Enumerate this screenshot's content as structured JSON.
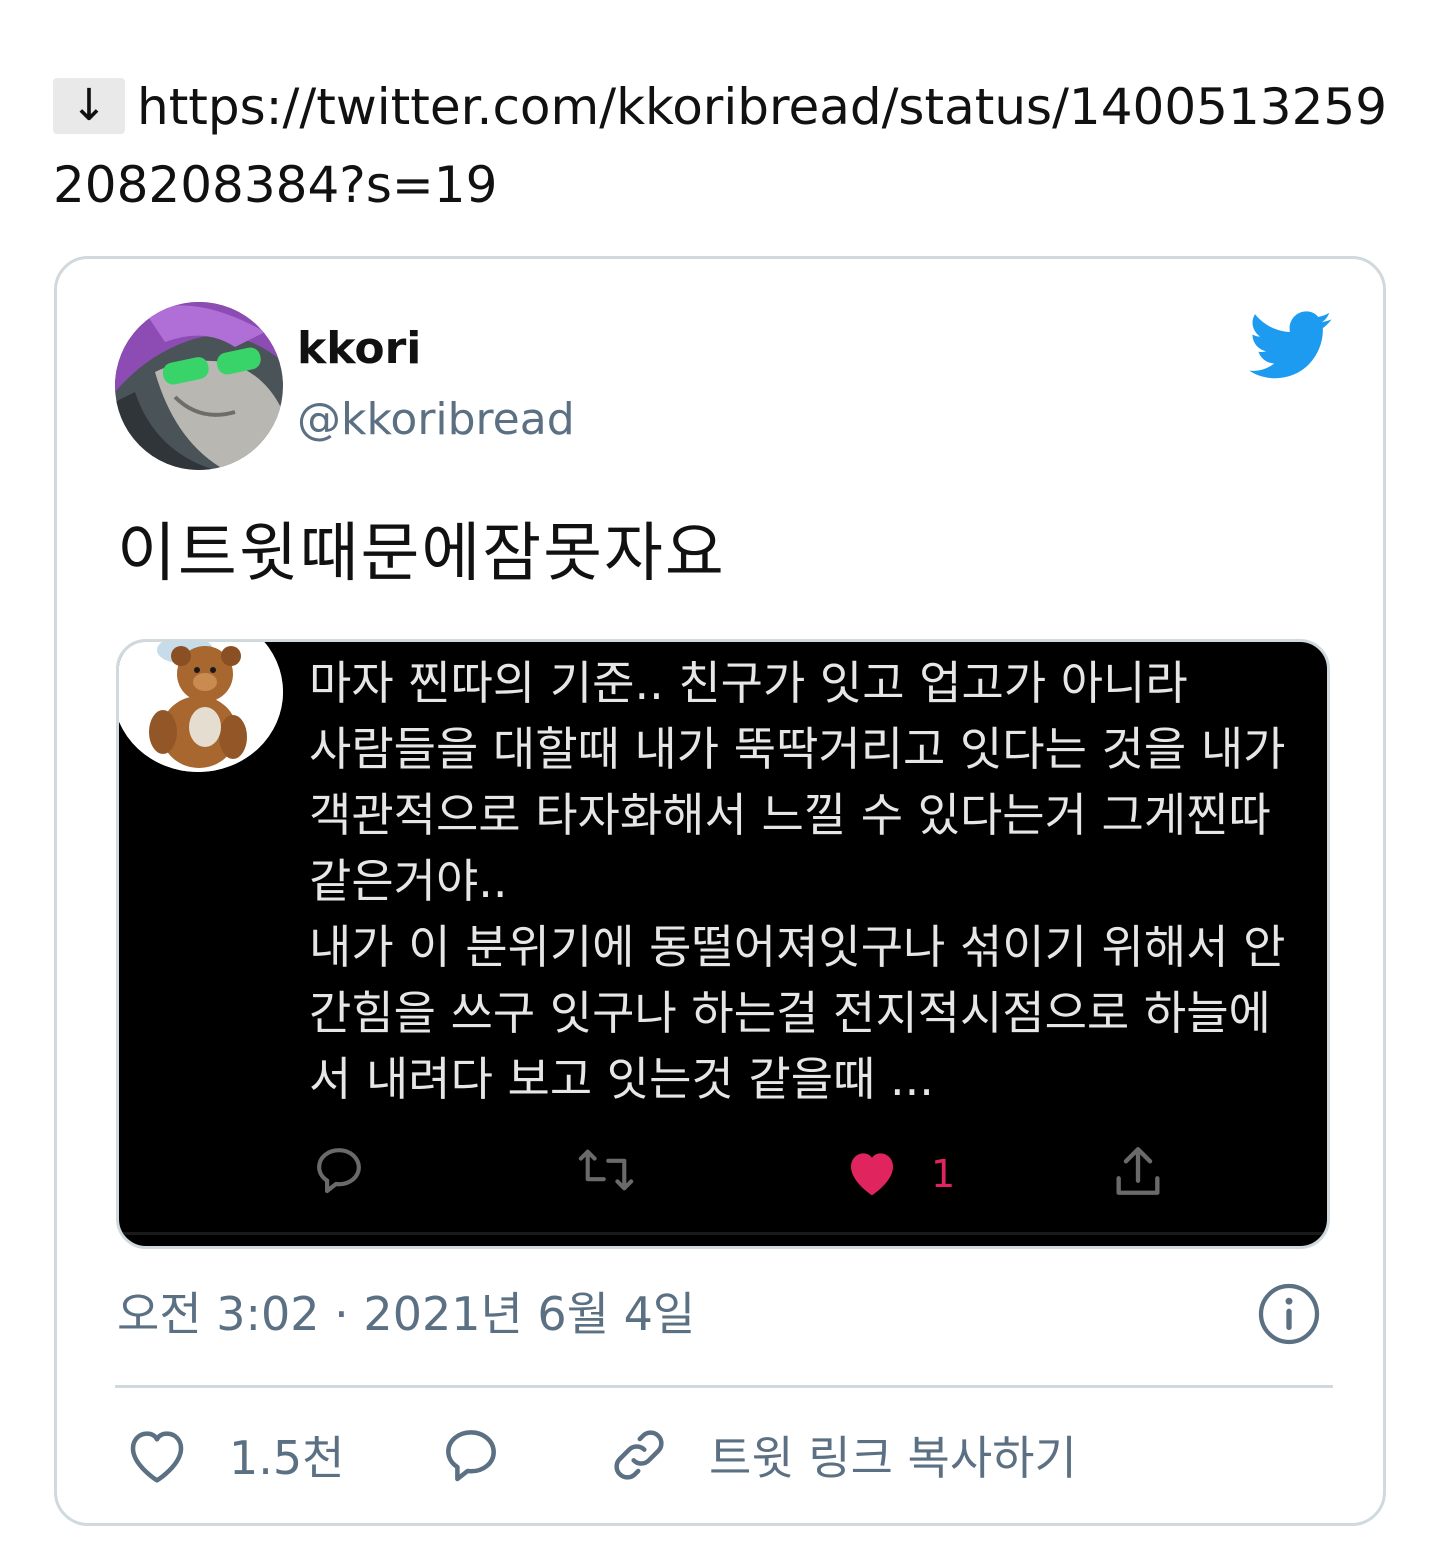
{
  "header": {
    "download_symbol": "↓",
    "url": "https://twitter.com/kkoribread/status/1400513259208208384?s=19"
  },
  "tweet": {
    "display_name": "kkori",
    "handle": "@kkoribread",
    "text": "이트윗때문에잠못자요",
    "timestamp": "오전 3:02 · 2021년 6월 4일",
    "like_count": "1.5천",
    "copy_link_label": "트윗 링크 복사하기"
  },
  "embedded_image": {
    "text": "마자 찐따의 기준.. 친구가 잇고 업고가 아니라\n사람들을 대할때 내가 뚝딱거리고 잇다는 것을 내가\n객관적으로 타자화해서 느낄 수 있다는거 그게찐따\n같은거야..\n내가 이 분위기에 동떨어져잇구나 섞이기 위해서 안\n간힘을 쓰구 잇구나 하는걸 전지적시점으로 하늘에\n서 내려다 보고 잇는것 같을때 ...",
    "like_count": "1"
  },
  "colors": {
    "twitter_blue": "#1d9bf0",
    "like_red": "#e0245e",
    "secondary_text": "#5b7083",
    "border": "#cfd9de"
  },
  "icons": {
    "bird": "twitter-bird-icon",
    "info": "info-icon",
    "heart": "heart-icon",
    "reply": "reply-icon",
    "link": "link-icon",
    "retweet": "retweet-icon",
    "share": "share-icon"
  }
}
